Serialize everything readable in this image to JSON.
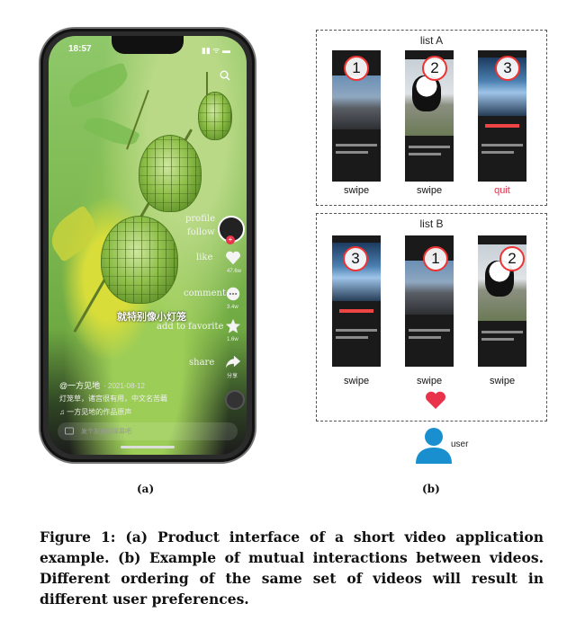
{
  "phone": {
    "time": "18:57",
    "status_icons": "▮▮ ᯤ ▬",
    "caption_zh": "就特别像小灯笼",
    "labels": {
      "profile": "profile",
      "follow": "follow",
      "like": "like",
      "comment": "comment",
      "favorite": "add to favorite",
      "share": "share"
    },
    "counts": {
      "like": "47.6w",
      "comment": "3.4w",
      "favorite": "1.6w",
      "share": "分享"
    },
    "poster": "@一方见地",
    "date": "· 2021-08-12",
    "description": "灯笼草，诸宫很有用，中文名苦蘵",
    "music": "♫ 一方见地的作品原声",
    "comment_placeholder": "发个友善的弹幕吧"
  },
  "lists": {
    "a": {
      "title": "list A",
      "items": [
        {
          "number": "1",
          "kind": "moto",
          "action": "swipe"
        },
        {
          "number": "2",
          "kind": "panda",
          "action": "swipe"
        },
        {
          "number": "3",
          "kind": "game",
          "action": "quit"
        }
      ]
    },
    "b": {
      "title": "list B",
      "items": [
        {
          "number": "3",
          "kind": "game",
          "action": "swipe"
        },
        {
          "number": "1",
          "kind": "moto",
          "action": "swipe"
        },
        {
          "number": "2",
          "kind": "panda",
          "action": "swipe"
        }
      ]
    }
  },
  "user_label": "user",
  "panel_labels": {
    "a": "(a)",
    "b": "(b)"
  },
  "caption": "Figure 1: (a) Product interface of a short video application example. (b) Example of mutual interactions between videos. Different ordering of the same set of videos will result in different user preferences.",
  "colors": {
    "accent_red": "#e0334a",
    "user_blue": "#1a8fd0"
  }
}
